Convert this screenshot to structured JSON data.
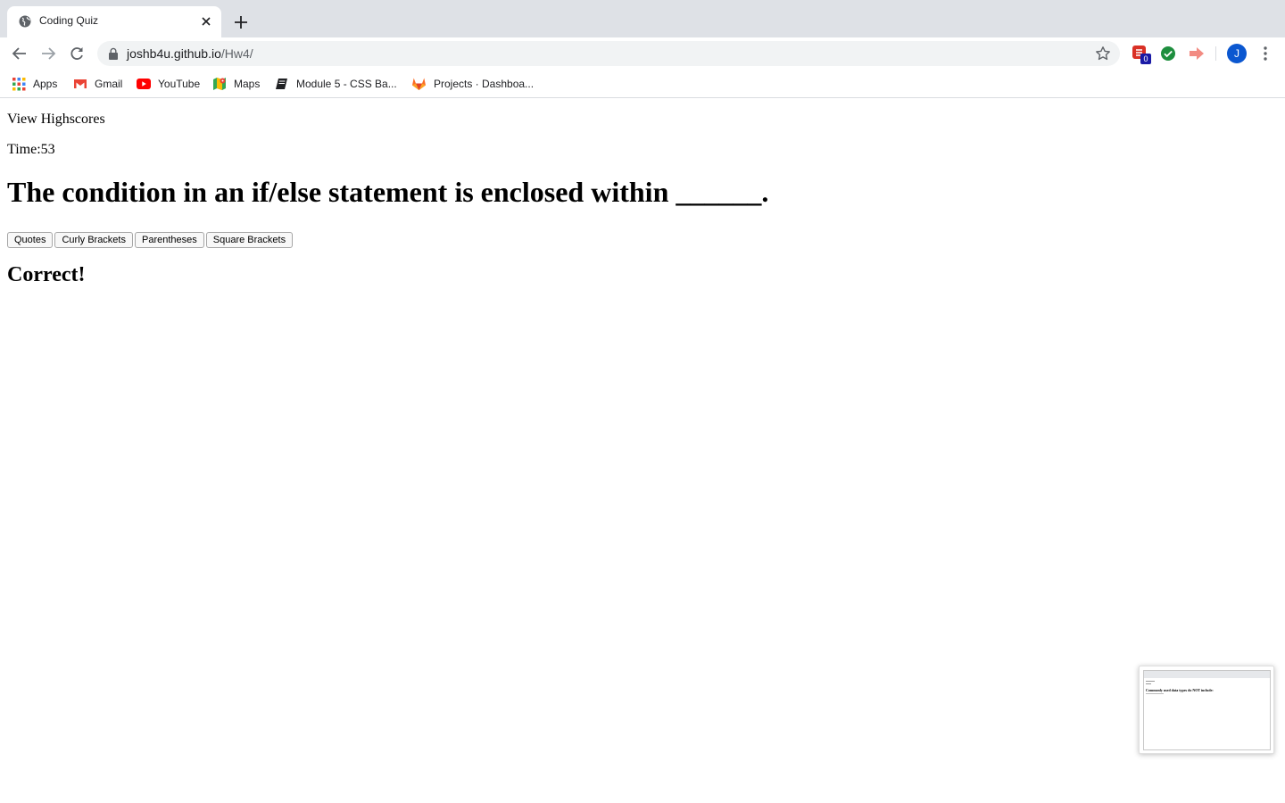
{
  "browser": {
    "tab_title": "Coding Quiz",
    "url_host": "joshb4u.github.io",
    "url_path": "/Hw4/",
    "extension_badge": "0",
    "avatar_initial": "J",
    "bookmarks": [
      {
        "label": "Apps",
        "icon": "apps-grid-icon"
      },
      {
        "label": "Gmail",
        "icon": "gmail-icon"
      },
      {
        "label": "YouTube",
        "icon": "youtube-icon"
      },
      {
        "label": "Maps",
        "icon": "maps-icon"
      },
      {
        "label": "Module 5 - CSS Ba...",
        "icon": "book-icon"
      },
      {
        "label": "Projects · Dashboa...",
        "icon": "gitlab-icon"
      }
    ]
  },
  "quiz": {
    "highscores_label": "View Highscores",
    "timer_label": "Time:",
    "timer_value": "53",
    "question": "The condition in an if/else statement is enclosed within ______.",
    "choices": [
      "Quotes",
      "Curly Brackets",
      "Parentheses",
      "Square Brackets"
    ],
    "feedback": "Correct!"
  },
  "preview": {
    "heading": "Commonly used data types do NOT include:"
  },
  "colors": {
    "tabstrip_bg": "#dee1e6",
    "omnibox_bg": "#f1f3f4",
    "avatar_bg": "#0b57d0",
    "extension_red": "#d93025",
    "extension_green": "#1e8e3e"
  }
}
